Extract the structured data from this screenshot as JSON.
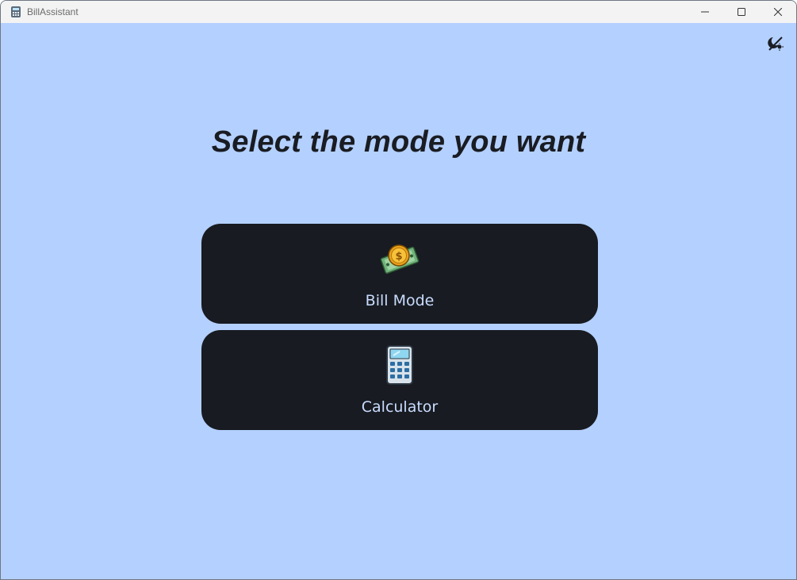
{
  "window": {
    "title": "BillAssistant",
    "controls": {
      "minimize": "minimize-icon",
      "maximize": "maximize-icon",
      "close": "close-icon"
    }
  },
  "toolbar": {
    "theme_toggle_icon": "brightness-toggle-icon"
  },
  "main": {
    "heading": "Select the mode you want",
    "modes": [
      {
        "label": "Bill Mode",
        "icon": "money-coin-icon"
      },
      {
        "label": "Calculator",
        "icon": "calculator-icon"
      }
    ]
  },
  "colors": {
    "background": "#b4d0ff",
    "card": "#181b21",
    "card_text": "#c9dcff",
    "heading_text": "#191c22"
  }
}
